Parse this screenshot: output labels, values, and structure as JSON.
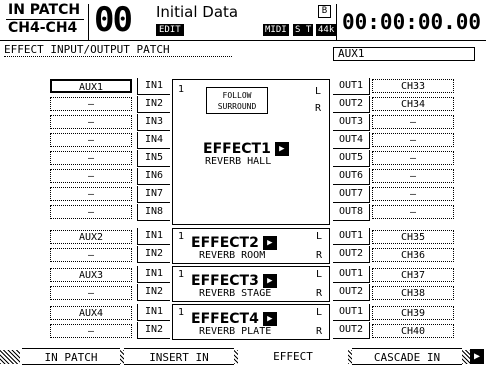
{
  "header": {
    "screen_title": "IN PATCH",
    "screen_sub": "CH4-CH4",
    "scene_number": "00",
    "scene_name": "Initial Data",
    "edit_badge": "EDIT",
    "lock_badge": "B",
    "midi_badge": "MIDI",
    "st_badge": "S T",
    "rate_badge": "44k",
    "timecode": "00:00:00.00"
  },
  "section": {
    "title": "EFFECT INPUT/OUTPUT PATCH",
    "selected_value": "AUX1"
  },
  "effect1": {
    "inputs": [
      "AUX1",
      "—",
      "—",
      "—",
      "—",
      "—",
      "—",
      "—"
    ],
    "in_labels": [
      "IN1",
      "IN2",
      "IN3",
      "IN4",
      "IN5",
      "IN6",
      "IN7",
      "IN8"
    ],
    "out_labels": [
      "OUT1",
      "OUT2",
      "OUT3",
      "OUT4",
      "OUT5",
      "OUT6",
      "OUT7",
      "OUT8"
    ],
    "outputs": [
      "CH33",
      "CH34",
      "—",
      "—",
      "—",
      "—",
      "—",
      "—"
    ],
    "num": "1",
    "follow_label": "FOLLOW SURROUND",
    "l": "L",
    "r": "R",
    "name": "EFFECT1",
    "program": "REVERB HALL"
  },
  "effects": [
    {
      "in1": "AUX2",
      "in2": "—",
      "num": "1",
      "name": "EFFECT2",
      "program": "REVERB ROOM",
      "l": "L",
      "r": "R",
      "out1": "CH35",
      "out2": "CH36"
    },
    {
      "in1": "AUX3",
      "in2": "—",
      "num": "1",
      "name": "EFFECT3",
      "program": "REVERB STAGE",
      "l": "L",
      "r": "R",
      "out1": "CH37",
      "out2": "CH38"
    },
    {
      "in1": "AUX4",
      "in2": "—",
      "num": "1",
      "name": "EFFECT4",
      "program": "REVERB PLATE",
      "l": "L",
      "r": "R",
      "out1": "CH39",
      "out2": "CH40"
    }
  ],
  "small_labels": {
    "in1": "IN1",
    "in2": "IN2",
    "out1": "OUT1",
    "out2": "OUT2"
  },
  "tabs": [
    "IN PATCH",
    "INSERT IN",
    "EFFECT",
    "CASCADE IN"
  ],
  "next_arrow": "▶",
  "edit_arrow": "▶"
}
